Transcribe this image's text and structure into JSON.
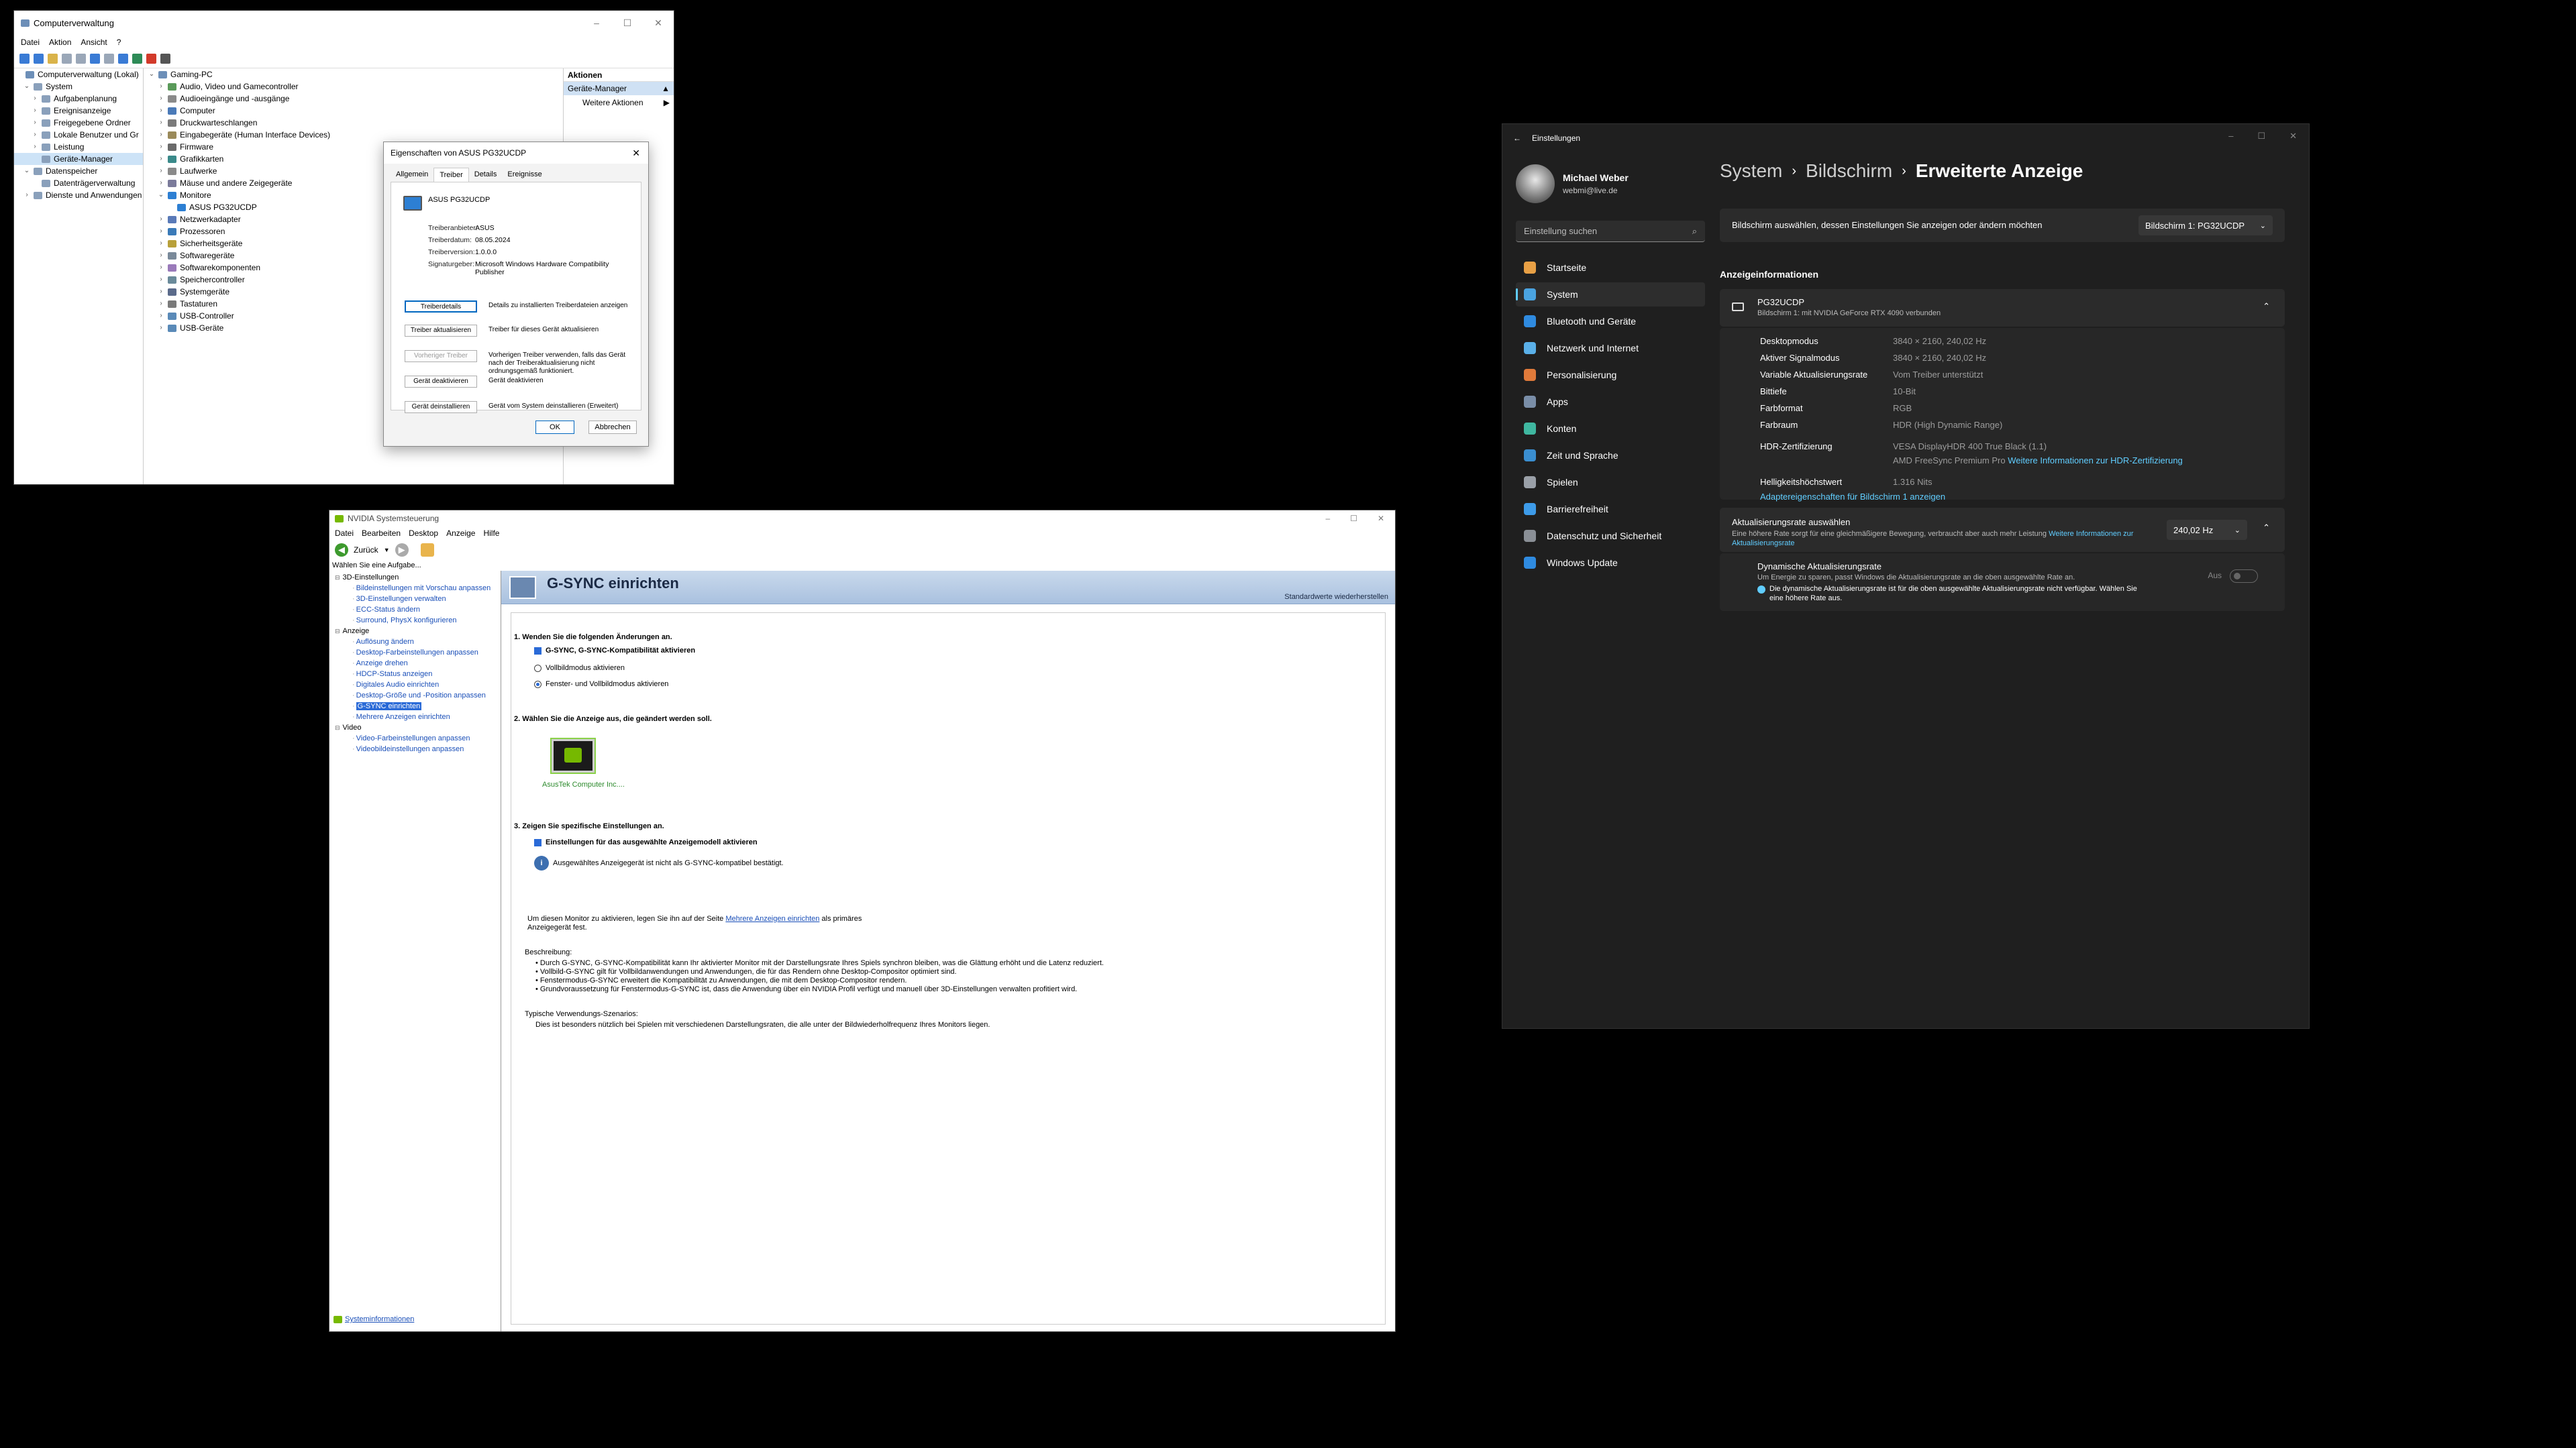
{
  "cm": {
    "title": "Computerverwaltung",
    "window_controls": [
      "–",
      "☐",
      "✕"
    ],
    "menu": [
      "Datei",
      "Aktion",
      "Ansicht",
      "?"
    ],
    "left_tree": [
      {
        "label": "Computerverwaltung (Lokal)",
        "level": 0,
        "exp": ""
      },
      {
        "label": "System",
        "level": 1,
        "exp": "⌄"
      },
      {
        "label": "Aufgabenplanung",
        "level": 2,
        "exp": "›"
      },
      {
        "label": "Ereignisanzeige",
        "level": 2,
        "exp": "›"
      },
      {
        "label": "Freigegebene Ordner",
        "level": 2,
        "exp": "›"
      },
      {
        "label": "Lokale Benutzer und Gr",
        "level": 2,
        "exp": "›"
      },
      {
        "label": "Leistung",
        "level": 2,
        "exp": "›"
      },
      {
        "label": "Geräte-Manager",
        "level": 2,
        "exp": "",
        "sel": true
      },
      {
        "label": "Datenspeicher",
        "level": 1,
        "exp": "⌄"
      },
      {
        "label": "Datenträgerverwaltung",
        "level": 2,
        "exp": ""
      },
      {
        "label": "Dienste und Anwendungen",
        "level": 1,
        "exp": "›"
      }
    ],
    "device_tree": [
      {
        "label": "Gaming-PC",
        "level": 0,
        "exp": "⌄"
      },
      {
        "label": "Audio, Video und Gamecontroller",
        "level": 1,
        "exp": "›"
      },
      {
        "label": "Audioeingänge und -ausgänge",
        "level": 1,
        "exp": "›"
      },
      {
        "label": "Computer",
        "level": 1,
        "exp": "›"
      },
      {
        "label": "Druckwarteschlangen",
        "level": 1,
        "exp": "›"
      },
      {
        "label": "Eingabegeräte (Human Interface Devices)",
        "level": 1,
        "exp": "›"
      },
      {
        "label": "Firmware",
        "level": 1,
        "exp": "›"
      },
      {
        "label": "Grafikkarten",
        "level": 1,
        "exp": "›"
      },
      {
        "label": "Laufwerke",
        "level": 1,
        "exp": "›"
      },
      {
        "label": "Mäuse und andere Zeigegeräte",
        "level": 1,
        "exp": "›"
      },
      {
        "label": "Monitore",
        "level": 1,
        "exp": "⌄"
      },
      {
        "label": "ASUS PG32UCDP",
        "level": 2,
        "exp": ""
      },
      {
        "label": "Netzwerkadapter",
        "level": 1,
        "exp": "›"
      },
      {
        "label": "Prozessoren",
        "level": 1,
        "exp": "›"
      },
      {
        "label": "Sicherheitsgeräte",
        "level": 1,
        "exp": "›"
      },
      {
        "label": "Softwaregeräte",
        "level": 1,
        "exp": "›"
      },
      {
        "label": "Softwarekomponenten",
        "level": 1,
        "exp": "›"
      },
      {
        "label": "Speichercontroller",
        "level": 1,
        "exp": "›"
      },
      {
        "label": "Systemgeräte",
        "level": 1,
        "exp": "›"
      },
      {
        "label": "Tastaturen",
        "level": 1,
        "exp": "›"
      },
      {
        "label": "USB-Controller",
        "level": 1,
        "exp": "›"
      },
      {
        "label": "USB-Geräte",
        "level": 1,
        "exp": "›"
      }
    ],
    "actions": {
      "header": "Aktionen",
      "section": "Geräte-Manager",
      "more": "Weitere Aktionen"
    }
  },
  "dialog": {
    "title": "Eigenschaften von ASUS PG32UCDP",
    "tabs": [
      "Allgemein",
      "Treiber",
      "Details",
      "Ereignisse"
    ],
    "device": "ASUS PG32UCDP",
    "props": [
      {
        "k": "Treiberanbieter:",
        "v": "ASUS"
      },
      {
        "k": "Treiberdatum:",
        "v": "08.05.2024"
      },
      {
        "k": "Treiberversion:",
        "v": "1.0.0.0"
      },
      {
        "k": "Signaturgeber:",
        "v": "Microsoft Windows Hardware Compatibility Publisher"
      }
    ],
    "buttons": [
      {
        "b": "Treiberdetails",
        "d": "Details zu installierten Treiberdateien anzeigen"
      },
      {
        "b": "Treiber aktualisieren",
        "d": "Treiber für dieses Gerät aktualisieren"
      },
      {
        "b": "Vorheriger Treiber",
        "d": "Vorherigen Treiber verwenden, falls das Gerät nach der Treiberaktualisierung nicht ordnungsgemäß funktioniert."
      },
      {
        "b": "Gerät deaktivieren",
        "d": "Gerät deaktivieren"
      },
      {
        "b": "Gerät deinstallieren",
        "d": "Gerät vom System deinstallieren (Erweitert)"
      }
    ],
    "ok": "OK",
    "cancel": "Abbrechen"
  },
  "nv": {
    "title": "NVIDIA Systemsteuerung",
    "menu": [
      "Datei",
      "Bearbeiten",
      "Desktop",
      "Anzeige",
      "Hilfe"
    ],
    "back": "Zurück",
    "task_header": "Wählen Sie eine Aufgabe...",
    "tree": [
      {
        "label": "3D-Einstellungen",
        "type": "cat"
      },
      {
        "label": "Bildeinstellungen mit Vorschau anpassen",
        "type": "link"
      },
      {
        "label": "3D-Einstellungen verwalten",
        "type": "link"
      },
      {
        "label": "ECC-Status ändern",
        "type": "link"
      },
      {
        "label": "Surround, PhysX konfigurieren",
        "type": "link"
      },
      {
        "label": "Anzeige",
        "type": "cat"
      },
      {
        "label": "Auflösung ändern",
        "type": "link"
      },
      {
        "label": "Desktop-Farbeinstellungen anpassen",
        "type": "link"
      },
      {
        "label": "Anzeige drehen",
        "type": "link"
      },
      {
        "label": "HDCP-Status anzeigen",
        "type": "link"
      },
      {
        "label": "Digitales Audio einrichten",
        "type": "link"
      },
      {
        "label": "Desktop-Größe und -Position anpassen",
        "type": "link"
      },
      {
        "label": "G-SYNC einrichten",
        "type": "sel"
      },
      {
        "label": "Mehrere Anzeigen einrichten",
        "type": "link"
      },
      {
        "label": "Video",
        "type": "cat"
      },
      {
        "label": "Video-Farbeinstellungen anpassen",
        "type": "link"
      },
      {
        "label": "Videobildeinstellungen anpassen",
        "type": "link"
      }
    ],
    "sysinfo": "Systeminformationen",
    "page_title": "G-SYNC einrichten",
    "restore": "Standardwerte wiederherstellen",
    "s1": "1. Wenden Sie die folgenden Änderungen an.",
    "s1_check": "G-SYNC, G-SYNC-Kompatibilität aktivieren",
    "s1_r1": "Vollbildmodus aktivieren",
    "s1_r2": "Fenster- und Vollbildmodus aktivieren",
    "s2": "2. Wählen Sie die Anzeige aus, die geändert werden soll.",
    "monitor": "AsusTek Computer Inc....",
    "s3": "3. Zeigen Sie spezifische Einstellungen an.",
    "s3_check": "Einstellungen für das ausgewählte Anzeigemodell aktivieren",
    "s3_info": "Ausgewähltes Anzeigegerät ist nicht als G-SYNC-kompatibel bestätigt.",
    "note_pre": "Um diesen Monitor zu aktivieren, legen Sie ihn auf der Seite ",
    "note_link": "Mehrere Anzeigen einrichten",
    "note_post": " als primäres Anzeigegerät fest.",
    "desc_h": "Beschreibung:",
    "desc": [
      "• Durch G-SYNC, G-SYNC-Kompatibilität kann Ihr aktivierter Monitor mit der Darstellungsrate Ihres Spiels synchron bleiben, was die Glättung erhöht und die Latenz reduziert.",
      "• Vollbild-G-SYNC gilt für Vollbildanwendungen und Anwendungen, die für das Rendern ohne Desktop-Compositor optimiert sind.",
      "• Fenstermodus-G-SYNC erweitert die Kompatibilität zu Anwendungen, die mit dem Desktop-Compositor rendern.",
      "• Grundvoraussetzung für Fenstermodus-G-SYNC ist, dass die Anwendung über ein NVIDIA Profil verfügt und manuell über 3D-Einstellungen verwalten profitiert wird."
    ],
    "usage_h": "Typische Verwendungs-Szenarios:",
    "usage": "Dies ist besonders nützlich bei Spielen mit verschiedenen Darstellungsraten, die alle unter der Bildwiederholfrequenz Ihres Monitors liegen."
  },
  "st": {
    "app": "Einstellungen",
    "user": "Michael Weber",
    "email": "webmi@live.de",
    "search_placeholder": "Einstellung suchen",
    "nav": [
      {
        "label": "Startseite",
        "color": "#e8a045"
      },
      {
        "label": "System",
        "color": "#4aa3e0",
        "active": true
      },
      {
        "label": "Bluetooth und Geräte",
        "color": "#2f8be0"
      },
      {
        "label": "Netzwerk und Internet",
        "color": "#5ab0e8"
      },
      {
        "label": "Personalisierung",
        "color": "#e07a3a"
      },
      {
        "label": "Apps",
        "color": "#7a8ea8"
      },
      {
        "label": "Konten",
        "color": "#3fb7a0"
      },
      {
        "label": "Zeit und Sprache",
        "color": "#3a8ed0"
      },
      {
        "label": "Spielen",
        "color": "#9aa0a8"
      },
      {
        "label": "Barrierefreiheit",
        "color": "#3d9be9"
      },
      {
        "label": "Datenschutz und Sicherheit",
        "color": "#8a8f96"
      },
      {
        "label": "Windows Update",
        "color": "#2f8be0"
      }
    ],
    "crumb": [
      "System",
      "Bildschirm",
      "Erweiterte Anzeige"
    ],
    "select_text": "Bildschirm auswählen, dessen Einstellungen Sie anzeigen oder ändern möchten",
    "select_value": "Bildschirm 1: PG32UCDP",
    "info_header": "Anzeigeinformationen",
    "mon_name": "PG32UCDP",
    "mon_sub": "Bildschirm 1: mit NVIDIA GeForce RTX 4090 verbunden",
    "rows": [
      {
        "k": "Desktopmodus",
        "v": "3840 × 2160, 240,02 Hz"
      },
      {
        "k": "Aktiver Signalmodus",
        "v": "3840 × 2160, 240,02 Hz"
      },
      {
        "k": "Variable Aktualisierungsrate",
        "v": "Vom Treiber unterstützt"
      },
      {
        "k": "Bittiefe",
        "v": "10-Bit"
      },
      {
        "k": "Farbformat",
        "v": "RGB"
      },
      {
        "k": "Farbraum",
        "v": "HDR (High Dynamic Range)"
      }
    ],
    "hdr_k": "HDR-Zertifizierung",
    "hdr_v1": "VESA DisplayHDR 400 True Black (1.1)",
    "hdr_v2": "AMD FreeSync Premium Pro",
    "hdr_link": "Weitere Informationen zur HDR-Zertifizierung",
    "bright_k": "Helligkeitshöchstwert",
    "bright_v": "1.316 Nits",
    "adapter_link": "Adaptereigenschaften für Bildschirm 1 anzeigen",
    "rate_title": "Aktualisierungsrate auswählen",
    "rate_desc": "Eine höhere Rate sorgt für eine gleichmäßigere Bewegung, verbraucht aber auch mehr Leistung",
    "rate_link": "Weitere Informationen zur Aktualisierungsrate",
    "rate_value": "240,02 Hz",
    "dyn_title": "Dynamische Aktualisierungsrate",
    "dyn_desc": "Um Energie zu sparen, passt Windows die Aktualisierungsrate an die oben ausgewählte Rate an.",
    "dyn_info": "Die dynamische Aktualisierungsrate ist für die oben ausgewählte Aktualisierungsrate nicht verfügbar. Wählen Sie eine höhere Rate aus.",
    "dyn_state": "Aus"
  }
}
